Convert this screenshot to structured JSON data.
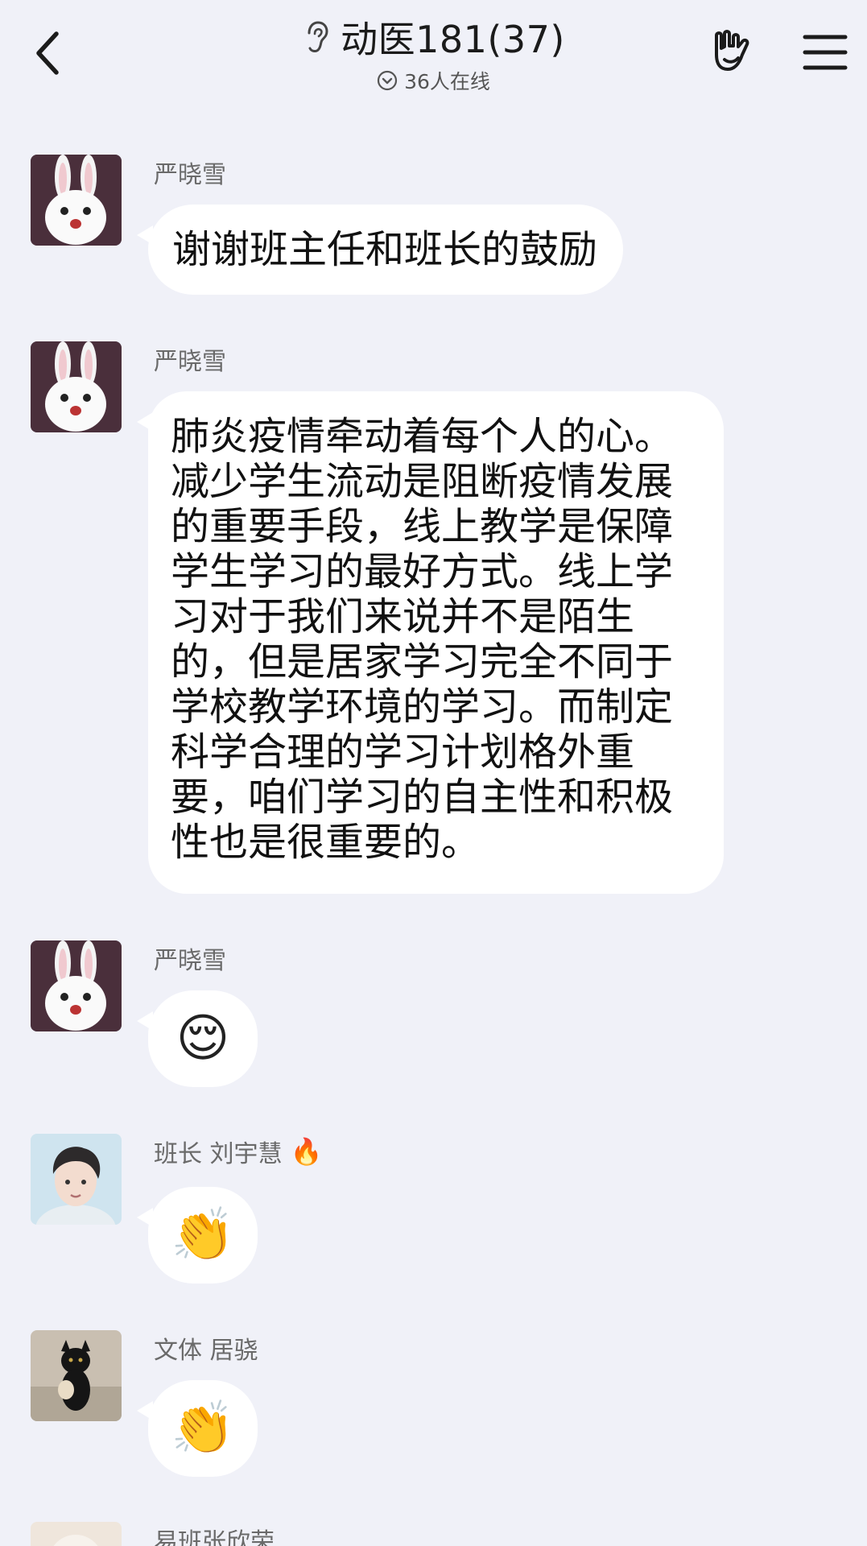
{
  "header": {
    "title": "动医181(37)",
    "online": "36人在线"
  },
  "messages": [
    {
      "sender": "严晓雪",
      "text": "谢谢班主任和班长的鼓励"
    },
    {
      "sender": "严晓雪",
      "text": "肺炎疫情牵动着每个人的心。减少学生流动是阻断疫情发展的重要手段，线上教学是保障学生学习的最好方式。线上学习对于我们来说并不是陌生的，但是居家学习完全不同于学校教学环境的学习。而制定科学合理的学习计划格外重要，咱们学习的自主性和积极性也是很重要的。"
    },
    {
      "sender": "严晓雪",
      "emoji": "😌"
    },
    {
      "sender": "班长 刘宇慧",
      "badge": "🔥",
      "emoji": "👏"
    },
    {
      "sender": "文体 居骁",
      "emoji": "👏"
    },
    {
      "sender": "易班张欣荣"
    }
  ],
  "icons": {
    "back": "chevron-left-icon",
    "ear": "ear-icon",
    "online": "chevron-circle-down-icon",
    "gesture": "rock-hand-icon",
    "menu": "hamburger-menu-icon"
  },
  "colors": {
    "background": "#f0f1f8",
    "bubble": "#ffffff"
  }
}
